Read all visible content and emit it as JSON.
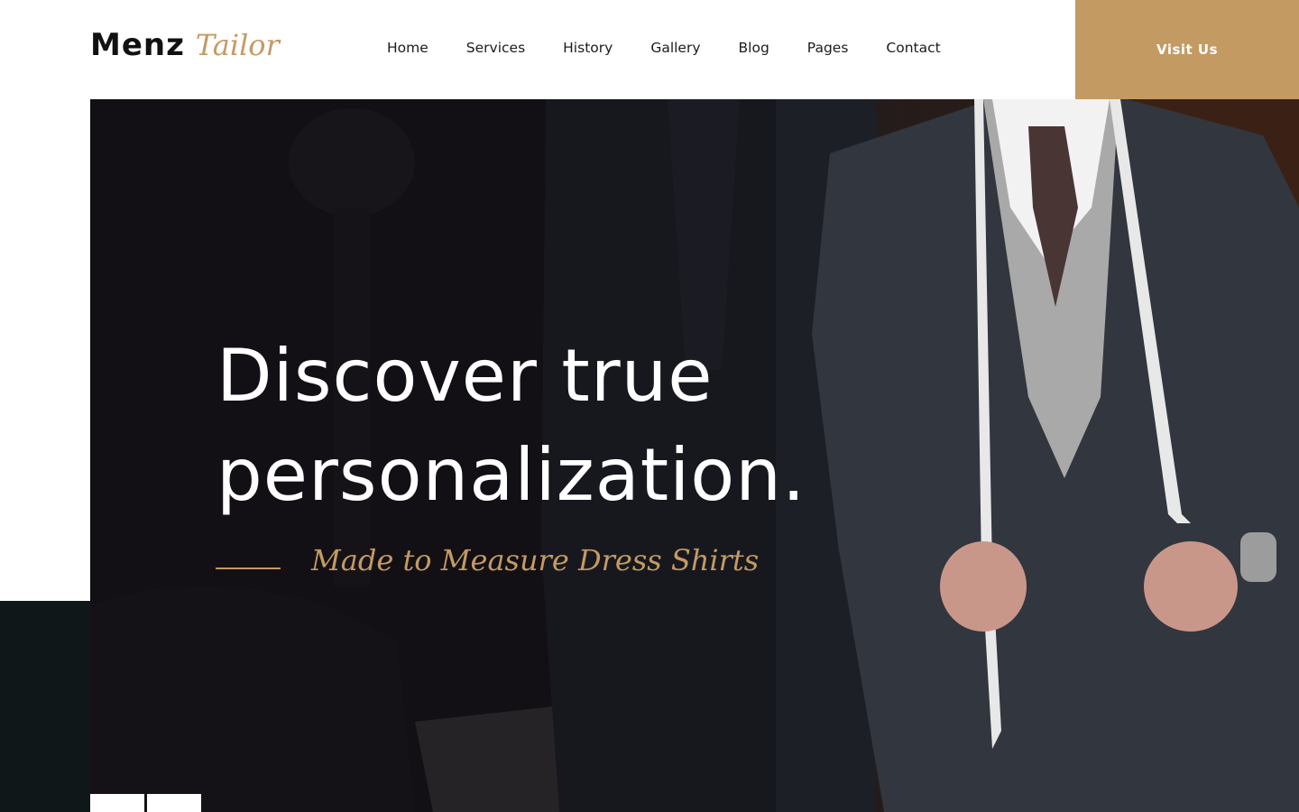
{
  "brand": {
    "name": "Menz",
    "script": "Tailor"
  },
  "nav": {
    "items": [
      "Home",
      "Services",
      "History",
      "Gallery",
      "Blog",
      "Pages",
      "Contact"
    ]
  },
  "cta": {
    "label": "Visit Us"
  },
  "hero": {
    "title_line1": "Discover true",
    "title_line2": "personalization.",
    "subtitle": "Made to Measure Dress Shirts"
  },
  "colors": {
    "accent": "#c49a63",
    "dark": "#0f1719",
    "hero_bg": "#161418"
  }
}
